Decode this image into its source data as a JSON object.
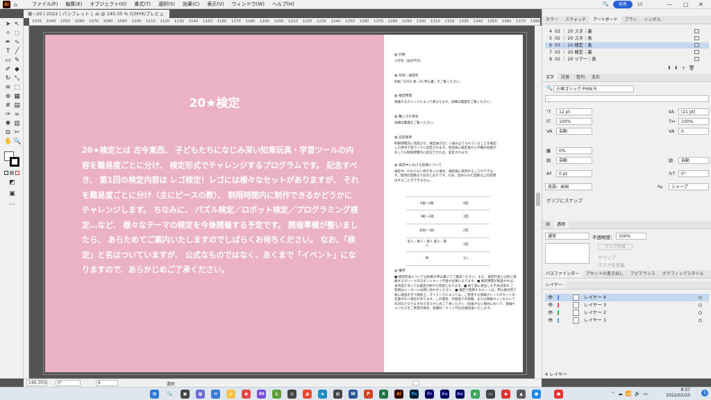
{
  "app": {
    "logo": "Ai",
    "menus": [
      "ファイル(F)",
      "編集(E)",
      "オブジェクト(O)",
      "書式(T)",
      "選択(S)",
      "効果(C)",
      "表示(V)",
      "ウィンドウ(W)",
      "ヘルプ(H)"
    ],
    "share": "共有",
    "window_controls": [
      "—",
      "▢",
      "✕"
    ]
  },
  "document": {
    "tab_title": "春☆20 | 2022 | パンフレット | .ai @ 140.35 % (CMYK/プレビュー)",
    "tab_close": "×"
  },
  "ruler": {
    "ticks": [
      "1030",
      "1040",
      "1050",
      "1060",
      "1070",
      "1080",
      "1090",
      "1100",
      "1110",
      "1120",
      "1130",
      "1140",
      "1150",
      "1160",
      "1170",
      "1180",
      "1190",
      "1200",
      "1210",
      "1220",
      "1230",
      "1240",
      "1250",
      "1260",
      "1270",
      "1280",
      "1290",
      "1300",
      "1310",
      "1320",
      "1330",
      "1340",
      "1350",
      "1360",
      "1370",
      "1380"
    ]
  },
  "artwork": {
    "title": "20★検定",
    "body": "20★検定とは 古今東西、 子どもたちになじみ深い知育玩具・学習ツールの内容を難易度ごとに分け、 検定形式でチャレンジするプログラムです。 記念すべき、 第1回の検定内容は レゴ検定！レゴには様々なセットがありますが、 それを難易度ごとに分け（主にピースの数）、 制限時間内に制作できるかどうかにチャレンジします。 ちなみに、 パズル検定／ロボット検定／プログラミング検定…など、 様々なテーマの検定を今後開催する予定です。 開催準備が整いましたら、 あらためてご案内いたしますのでしばらくお待ちください。 なお、「検定」と名はついていますが、 公式なものではなく、あくまで「イベント」になりますので、あらかじめご了承ください。",
    "sections": [
      {
        "h": "対象",
        "t": "小学生（幼児不可）"
      },
      {
        "h": "日程・検定料",
        "t": "別紙「2022 春☆20 申込書」をご覧ください。"
      },
      {
        "h": "検定時間",
        "t": "受験するグレードによって異なります。詳細は裏面をご覧ください。"
      },
      {
        "h": "難しさの目安",
        "t": "詳細は裏面をご覧ください。"
      },
      {
        "h": "認定基準",
        "t": "制限時間内に完成させ、検定員が正しく組み立てられていることを確認した時点で各ランクに認定されます。完成後に検定員から不備の指摘があっても制限時間内に修正できれば、認定されます。"
      },
      {
        "h": "検定中における質問について",
        "t": "検定中、わからない所があった場合、検定員に質問することができます。質問の回数は下記のとおりです。なお、定められた回数以上の質問はすることができません。"
      }
    ],
    "table": [
      {
        "a": "6級〜4級",
        "b": "4回"
      },
      {
        "a": "3級〜1級",
        "b": "3回"
      },
      {
        "a": "初段〜3段",
        "b": "2回"
      },
      {
        "a": "名人・師人・達人 超人・聖人",
        "b": "1回"
      },
      {
        "a": "神",
        "b": "なし"
      }
    ],
    "notes_h": "備考",
    "notes": "■ 検定料金については別紙の申込書にてご確認ください。また、検定料金とは別に受験するグレードのロボットキット代金が必要になります。■ 検定時間が経過すれば、未完成であっても検定が終わり完成となります。■ 終了後に発生した不具合等の ご質問はメーカーにお問い合わせください。■ 検定で使用するキットは、申込受付完了後に発送を行う関係上、タイミングによっては、ご希望する受験グレードのキットの在庫がない場合があります。この場合、代替品での受験、または受験キャンセルにての対応となりますのであらかじめご了承ください（在庫がない場合において、受験キャンセルをご希望の場合、受験料・キット代は全額返金いたします。"
  },
  "status": {
    "zoom": "140.35%",
    "angle": "0°",
    "page": "6",
    "mode": "選択"
  },
  "panel": {
    "top_tabs": [
      "カラー",
      "スウォッチ",
      "アートボード",
      "ブラシ",
      "シンボル"
    ],
    "artboards": [
      {
        "n": "4",
        "name": "02 ｜ 20 スタ｜裏",
        "sel": false
      },
      {
        "n": "5",
        "name": "02 ｜ 20 スタ｜表",
        "sel": false
      },
      {
        "n": "6",
        "name": "03 ｜ 20 検定｜表",
        "sel": true
      },
      {
        "n": "7",
        "name": "02 ｜ 20 検定｜裏",
        "sel": false
      },
      {
        "n": "8",
        "name": "02 ｜ 20 ツアー｜表",
        "sel": false
      }
    ],
    "char_tabs": [
      "文字",
      "段落",
      "整列",
      "変形"
    ],
    "font": "小塚ゴシック Pr6N R",
    "font_style": "-",
    "size": "12 pt",
    "leading": "(21 pt)",
    "vscale": "100%",
    "hscale": "100%",
    "kern": "自動",
    "track": "0",
    "tsume": "0%",
    "auto": "自動",
    "baseline": "0 pt",
    "rotate": "0°",
    "lang": "英語：米国",
    "aa": "シャープ",
    "snap": "グリフにスナップ",
    "trans_tabs": [
      "線",
      "透明"
    ],
    "blend": "通常",
    "opacity_label": "不透明度：",
    "opacity": "100%",
    "mask_btn": "マスク作成",
    "clip": "クリップ",
    "invert": "マスクを反転",
    "layer_tabs": [
      "パスファインダー",
      "アセットの書き出し",
      "アピアランス",
      "グラフィックスタイル"
    ],
    "layers_tab": "レイヤー",
    "layers": [
      {
        "name": "レイヤー 4",
        "color": "#4f7fff",
        "sel": true
      },
      {
        "name": "レイヤー 3",
        "color": "#e34a4a",
        "sel": false
      },
      {
        "name": "レイヤー 2",
        "color": "#3fbf3f",
        "sel": false
      },
      {
        "name": "レイヤー 1",
        "color": "#4f9fff",
        "sel": false
      }
    ],
    "layer_count": "4 レイヤー"
  },
  "taskbar": {
    "time": "8:37",
    "date": "2022/02/10",
    "badge": "1",
    "notif": "30"
  }
}
